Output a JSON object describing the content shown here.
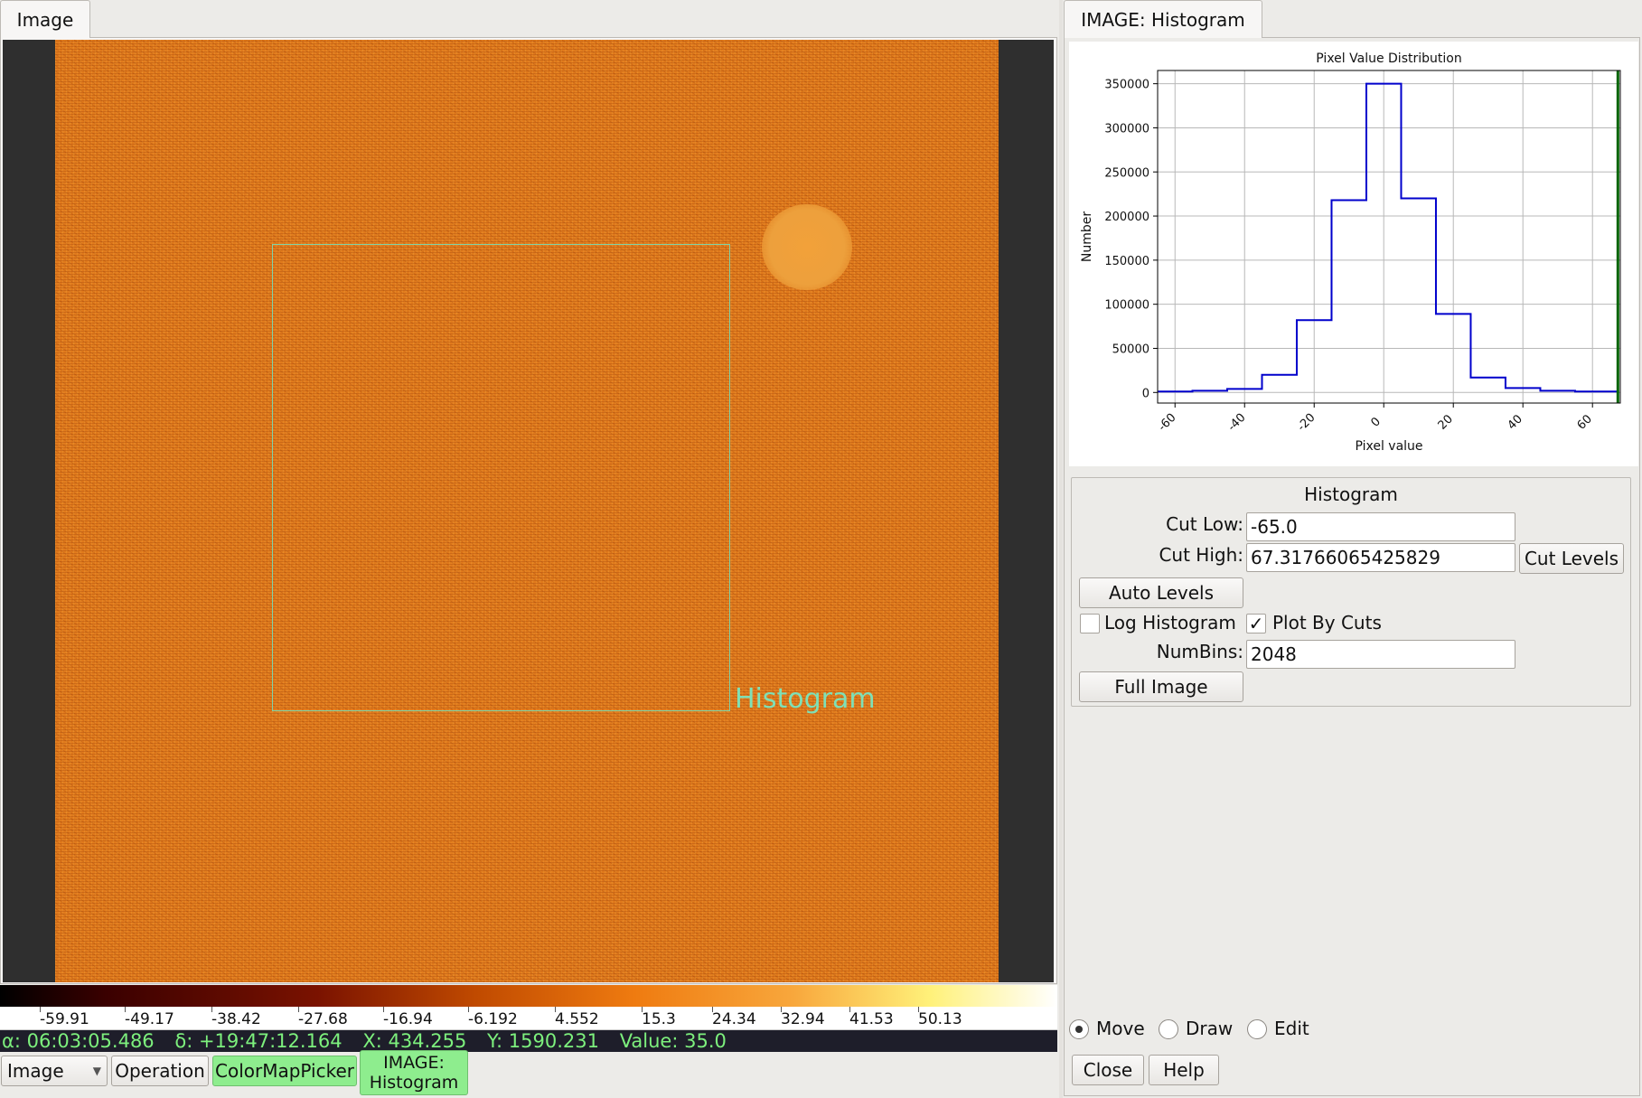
{
  "left": {
    "tab_label": "Image",
    "overlay_label": "Histogram",
    "colorbar_ticks": [
      "-59.91",
      "-49.17",
      "-38.42",
      "-27.68",
      "-16.94",
      "-6.192",
      "4.552",
      "15.3",
      "24.34",
      "32.94",
      "41.53",
      "50.13"
    ],
    "readout": {
      "ra": "α: 06:03:05.486",
      "dec": "δ: +19:47:12.164",
      "x": "X: 434.255",
      "y": "Y: 1590.231",
      "value": "Value: 35.0"
    },
    "toolbar": {
      "image_select": "Image",
      "operation": "Operation",
      "colormap_picker": "ColorMapPicker",
      "histogram_line1": "IMAGE:",
      "histogram_line2": "Histogram"
    },
    "colors": {
      "image_base": "#e07a1c",
      "roi": "#7fd3a8",
      "active_plugin": "#8eed8e"
    }
  },
  "right": {
    "tab_label": "IMAGE: Histogram",
    "chart_data": {
      "type": "line",
      "title": "Pixel Value Distribution",
      "xlabel": "Pixel value",
      "ylabel": "Number",
      "xlim": [
        -65,
        68
      ],
      "ylim": [
        -12000,
        365000
      ],
      "xticks": [
        -60,
        -40,
        -20,
        0,
        20,
        40,
        60
      ],
      "yticks": [
        0,
        50000,
        100000,
        150000,
        200000,
        250000,
        300000,
        350000
      ],
      "grid": true,
      "step_x": [
        -65,
        -55,
        -45,
        -35,
        -25,
        -15,
        -5,
        5,
        15,
        25,
        35,
        45,
        55,
        67.3
      ],
      "step_y": [
        1000,
        2000,
        4000,
        20000,
        82000,
        218000,
        350000,
        220000,
        89000,
        17000,
        5000,
        2000,
        1000
      ],
      "line_color": "#0000cc",
      "cut_line_x": 67.3,
      "cut_line_color": "#006400"
    },
    "panel": {
      "title": "Histogram",
      "cut_low_label": "Cut Low:",
      "cut_low_value": "-65.0",
      "cut_high_label": "Cut High:",
      "cut_high_value": "67.31766065425829",
      "cut_levels_button": "Cut Levels",
      "auto_levels_button": "Auto Levels",
      "log_histogram_label": "Log Histogram",
      "log_histogram_checked": false,
      "plot_by_cuts_label": "Plot By Cuts",
      "plot_by_cuts_checked": true,
      "plot_by_cuts_mark": "✓",
      "numbins_label": "NumBins:",
      "numbins_value": "2048",
      "full_image_button": "Full Image"
    },
    "mode": {
      "move": "Move",
      "draw": "Draw",
      "edit": "Edit",
      "selected": "Move"
    },
    "close_button": "Close",
    "help_button": "Help"
  }
}
